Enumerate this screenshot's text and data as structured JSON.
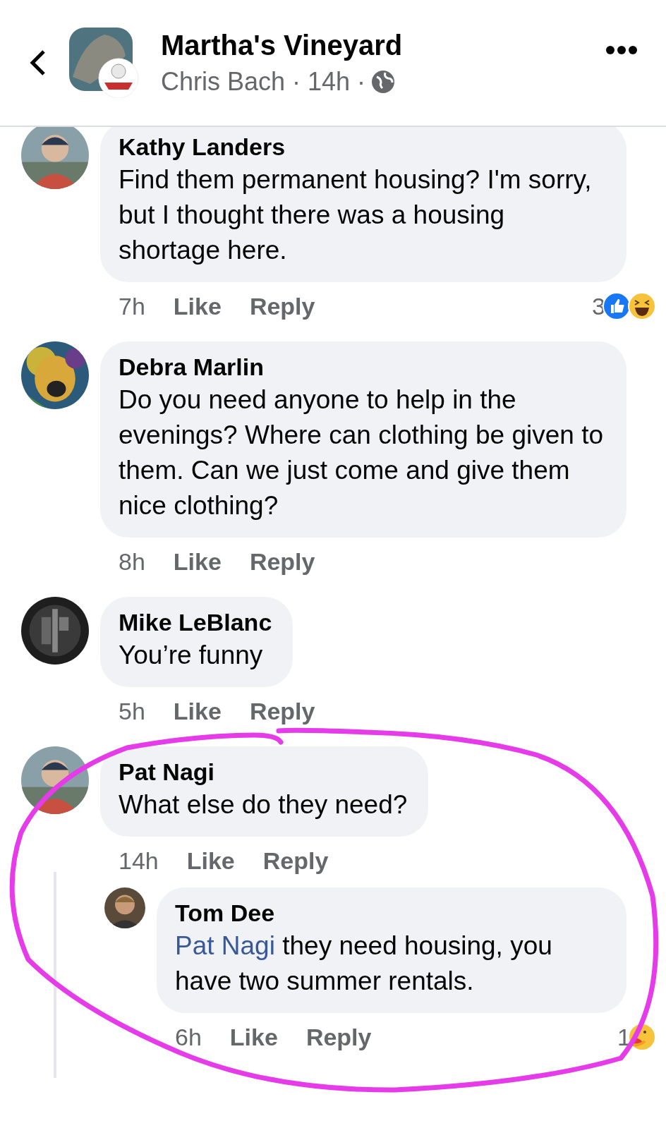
{
  "header": {
    "title": "Martha's Vineyard",
    "subtitle": "Chris Bach · 14h ·"
  },
  "comments": [
    {
      "author": "Kathy Landers",
      "text": "Find them permanent housing? I'm sorry, but I thought there was a housing shortage here.",
      "time": "7h",
      "like": "Like",
      "reply": "Reply",
      "reaction_count": "3",
      "reactions": [
        {
          "kind": "like"
        },
        {
          "kind": "haha"
        }
      ]
    },
    {
      "author": "Debra Marlin",
      "text": "Do you need anyone to help in the evenings? Where can clothing be given to them. Can we just come and give them nice clothing?",
      "time": "8h",
      "like": "Like",
      "reply": "Reply"
    },
    {
      "author": "Mike LeBlanc",
      "text": "You’re funny",
      "time": "5h",
      "like": "Like",
      "reply": "Reply"
    },
    {
      "author": "Pat Nagi",
      "text": "What else do they need?",
      "time": "14h",
      "like": "Like",
      "reply": "Reply",
      "replies": [
        {
          "author": "Tom Dee",
          "mention": "Pat Nagi",
          "text": "they need housing, you have two summer rentals.",
          "time": "6h",
          "like": "Like",
          "reply": "Reply",
          "reaction_count": "1",
          "reactions": [
            {
              "kind": "care"
            }
          ]
        }
      ]
    }
  ]
}
